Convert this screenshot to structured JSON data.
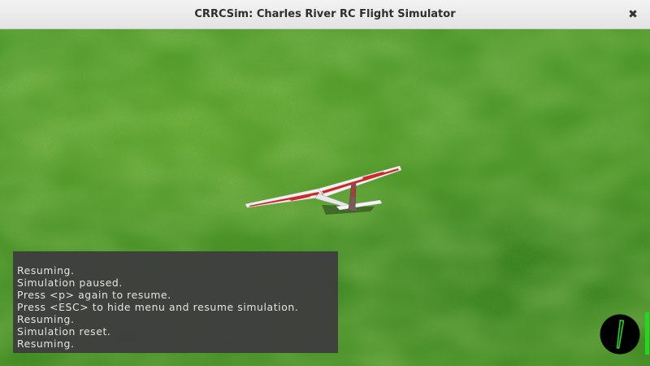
{
  "window": {
    "title": "CRRCSim: Charles River RC Flight Simulator",
    "close_icon": "close-icon"
  },
  "scene": {
    "ground": "grass",
    "aircraft": "rc-glider-model",
    "colors": {
      "grass_light": "#5aa82c",
      "grass_dark": "#3a8a1f",
      "wing_white": "#f2f2f2",
      "wing_red": "#d02828"
    }
  },
  "console": {
    "lines": [
      "Resuming.",
      "Simulation paused.",
      "Press <p> again to resume.",
      "Press <ESC> to hide menu and resume simulation.",
      "Resuming.",
      "Simulation reset.",
      "Resuming."
    ]
  },
  "hud": {
    "radar_icon": "radar-icon",
    "throttle_level": 1.0,
    "colors": {
      "radar_bg": "#000000",
      "radar_needle": "#22d622",
      "throttle": "#22d622"
    }
  }
}
